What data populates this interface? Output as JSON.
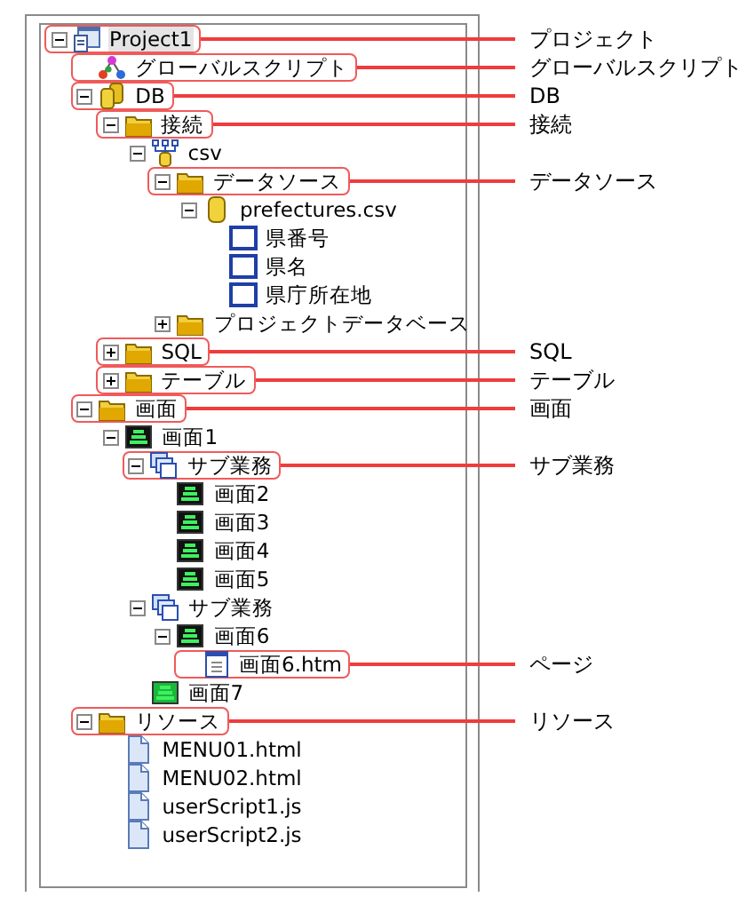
{
  "tree": [
    {
      "label": "Project1",
      "kind": "project",
      "expanded": true,
      "selected": true,
      "callout": "プロジェクト",
      "children": [
        {
          "label": "グローバルスクリプト",
          "kind": "script",
          "selected": false,
          "callout": "グローバルスクリプト"
        },
        {
          "label": "DB",
          "kind": "database",
          "expanded": true,
          "selected": false,
          "callout": "DB",
          "children": [
            {
              "label": "接続",
              "kind": "folder",
              "expanded": true,
              "selected": false,
              "callout": "接続",
              "children": [
                {
                  "label": "csv",
                  "kind": "connection",
                  "expanded": true,
                  "selected": false,
                  "children": [
                    {
                      "label": "データソース",
                      "kind": "folder",
                      "expanded": true,
                      "selected": false,
                      "callout": "データソース",
                      "children": [
                        {
                          "label": "prefectures.csv",
                          "kind": "datafile",
                          "expanded": true,
                          "selected": false,
                          "children": [
                            {
                              "label": "県番号",
                              "kind": "column",
                              "selected": false
                            },
                            {
                              "label": "県名",
                              "kind": "column",
                              "selected": false
                            },
                            {
                              "label": "県庁所在地",
                              "kind": "column",
                              "selected": false
                            }
                          ]
                        }
                      ]
                    },
                    {
                      "label": "プロジェクトデータベース",
                      "kind": "folder",
                      "expanded": false,
                      "selected": false
                    }
                  ]
                }
              ]
            },
            {
              "label": "SQL",
              "kind": "folder",
              "expanded": false,
              "selected": false,
              "callout": "SQL"
            },
            {
              "label": "テーブル",
              "kind": "folder",
              "expanded": false,
              "selected": false,
              "callout": "テーブル"
            }
          ]
        },
        {
          "label": "画面",
          "kind": "folder",
          "expanded": true,
          "selected": false,
          "callout": "画面",
          "children": [
            {
              "label": "画面1",
              "kind": "screen",
              "expanded": true,
              "selected": false,
              "children": [
                {
                  "label": "サブ業務",
                  "kind": "subtask",
                  "expanded": true,
                  "selected": false,
                  "callout": "サブ業務",
                  "children": [
                    {
                      "label": "画面2",
                      "kind": "screen",
                      "selected": false
                    },
                    {
                      "label": "画面3",
                      "kind": "screen",
                      "selected": false
                    },
                    {
                      "label": "画面4",
                      "kind": "screen",
                      "selected": false
                    },
                    {
                      "label": "画面5",
                      "kind": "screen",
                      "selected": false
                    }
                  ]
                },
                {
                  "label": "サブ業務",
                  "kind": "subtask",
                  "expanded": true,
                  "selected": false,
                  "children": [
                    {
                      "label": "画面6",
                      "kind": "screen",
                      "expanded": true,
                      "selected": false,
                      "children": [
                        {
                          "label": "画面6.htm",
                          "kind": "page",
                          "selected": false,
                          "callout": "ページ"
                        }
                      ]
                    }
                  ]
                },
                {
                  "label": "画面7",
                  "kind": "start-screen",
                  "selected": false
                }
              ]
            }
          ]
        },
        {
          "label": "リソース",
          "kind": "folder",
          "expanded": true,
          "selected": false,
          "callout": "リソース",
          "children": [
            {
              "label": "MENU01.html",
              "kind": "file",
              "selected": false
            },
            {
              "label": "MENU02.html",
              "kind": "file",
              "selected": false
            },
            {
              "label": "userScript1.js",
              "kind": "file",
              "selected": false
            },
            {
              "label": "userScript2.js",
              "kind": "file",
              "selected": false
            }
          ]
        }
      ]
    }
  ]
}
